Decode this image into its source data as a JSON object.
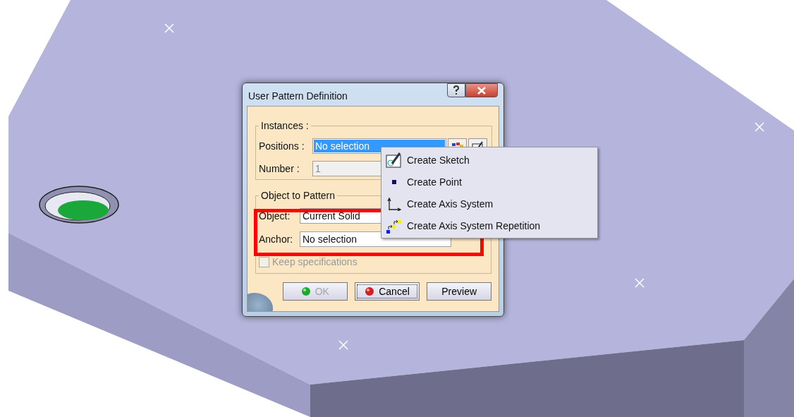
{
  "dialog": {
    "title": "User Pattern Definition",
    "instances": {
      "title": "Instances :",
      "positions_label": "Positions :",
      "positions_value": "No selection",
      "positions_highlighted": true,
      "number_label": "Number :",
      "number_value": "1",
      "number_disabled": true
    },
    "object_group": {
      "title": "Object to Pattern",
      "object_label": "Object:",
      "object_value": "Current Solid",
      "anchor_label": "Anchor:",
      "anchor_value": "No selection"
    },
    "keep_specifications": {
      "label": "Keep specifications",
      "checked": false,
      "disabled": true
    },
    "buttons": [
      {
        "kind": "ok",
        "label": "OK",
        "disabled": true
      },
      {
        "kind": "cancel",
        "label": "Cancel",
        "disabled": false
      },
      {
        "kind": "preview",
        "label": "Preview",
        "disabled": false
      }
    ]
  },
  "context_menu": {
    "items": [
      {
        "kind": "sketch",
        "label": "Create Sketch"
      },
      {
        "kind": "point",
        "label": "Create Point"
      },
      {
        "kind": "axis",
        "label": "Create Axis System"
      },
      {
        "kind": "axis-repetition",
        "label": "Create Axis System Repetition"
      }
    ]
  }
}
